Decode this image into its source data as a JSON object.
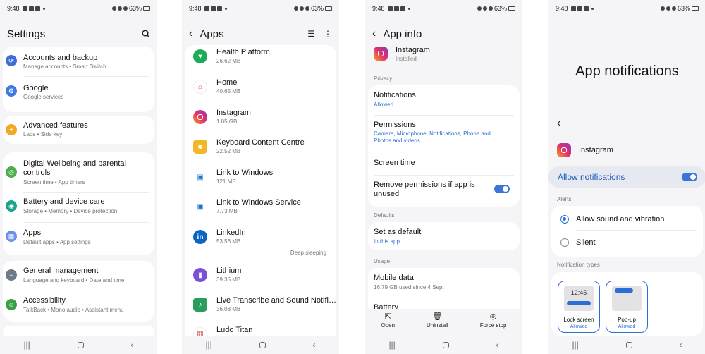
{
  "status": {
    "time": "9:48",
    "battery": "63%"
  },
  "nav": {
    "recents": "|||",
    "back": "‹"
  },
  "settings": {
    "title": "Settings",
    "items": [
      {
        "title": "Accounts and backup",
        "sub": "Manage accounts  •  Smart Switch",
        "icon": "sync-icon",
        "color": "#3d6fd6"
      },
      {
        "title": "Google",
        "sub": "Google services",
        "icon": "google-icon",
        "color": "#3d7be0"
      },
      {
        "title": "Advanced features",
        "sub": "Labs  •  Side key",
        "icon": "star-gear-icon",
        "color": "#f3a824"
      },
      {
        "title": "Digital Wellbeing and parental controls",
        "sub": "Screen time  •  App timers",
        "icon": "wellbeing-icon",
        "color": "#4cae50"
      },
      {
        "title": "Battery and device care",
        "sub": "Storage  •  Memory  •  Device protection",
        "icon": "device-care-icon",
        "color": "#1ea38a"
      },
      {
        "title": "Apps",
        "sub": "Default apps  •  App settings",
        "icon": "apps-grid-icon",
        "color": "#6e8ff0"
      },
      {
        "title": "General management",
        "sub": "Language and keyboard  •  Date and time",
        "icon": "sliders-icon",
        "color": "#6e7a88"
      },
      {
        "title": "Accessibility",
        "sub": "TalkBack  •  Mono audio  •  Assistant menu",
        "icon": "accessibility-icon",
        "color": "#3aa047"
      }
    ]
  },
  "apps": {
    "title": "Apps",
    "items": [
      {
        "name": "Health Platform",
        "size": "26.62 MB",
        "color": "#1faa5a"
      },
      {
        "name": "Home",
        "size": "40.65 MB",
        "color": "#ffffff"
      },
      {
        "name": "Instagram",
        "size": "1.85 GB",
        "color": "ig"
      },
      {
        "name": "Keyboard Content Centre",
        "size": "22.52 MB",
        "color": "#f2b626"
      },
      {
        "name": "Link to Windows",
        "size": "121 MB",
        "color": "#ffffff"
      },
      {
        "name": "Link to Windows Service",
        "size": "7.73 MB",
        "color": "#ffffff"
      },
      {
        "name": "LinkedIn",
        "size": "53.56 MB",
        "color": "#0a66c2",
        "badge": "Deep sleeping"
      },
      {
        "name": "Lithium",
        "size": "39.35 MB",
        "color": "#7b4fd8"
      },
      {
        "name": "Live Transcribe and Sound Notifications",
        "size": "36.08 MB",
        "color": "#2a9d5c"
      },
      {
        "name": "Ludo Titan",
        "size": "",
        "color": "#ffffff"
      }
    ]
  },
  "appinfo": {
    "title": "App info",
    "app_name": "Instagram",
    "app_status": "Installed",
    "privacy_label": "Privacy",
    "notifications": {
      "title": "Notifications",
      "sub": "Allowed"
    },
    "permissions": {
      "title": "Permissions",
      "sub": "Camera, Microphone, Notifications, Phone and Photos and videos"
    },
    "screen_time": "Screen time",
    "remove_permissions": "Remove permissions if app is unused",
    "defaults_label": "Defaults",
    "set_default": {
      "title": "Set as default",
      "sub": "In this app"
    },
    "usage_label": "Usage",
    "mobile_data": {
      "title": "Mobile data",
      "sub": "16.79 GB used since 4 Sept"
    },
    "battery": "Battery",
    "actions": {
      "open": "Open",
      "uninstall": "Uninstall",
      "force_stop": "Force stop"
    }
  },
  "notif": {
    "title": "App notifications",
    "app_name": "Instagram",
    "allow": "Allow notifications",
    "alerts_label": "Alerts",
    "sound": "Allow sound and vibration",
    "silent": "Silent",
    "types_label": "Notification types",
    "lock": {
      "label": "Lock screen",
      "sub": "Allowed",
      "time": "12:45"
    },
    "popup": {
      "label": "Pop-up",
      "sub": "Allowed"
    }
  }
}
